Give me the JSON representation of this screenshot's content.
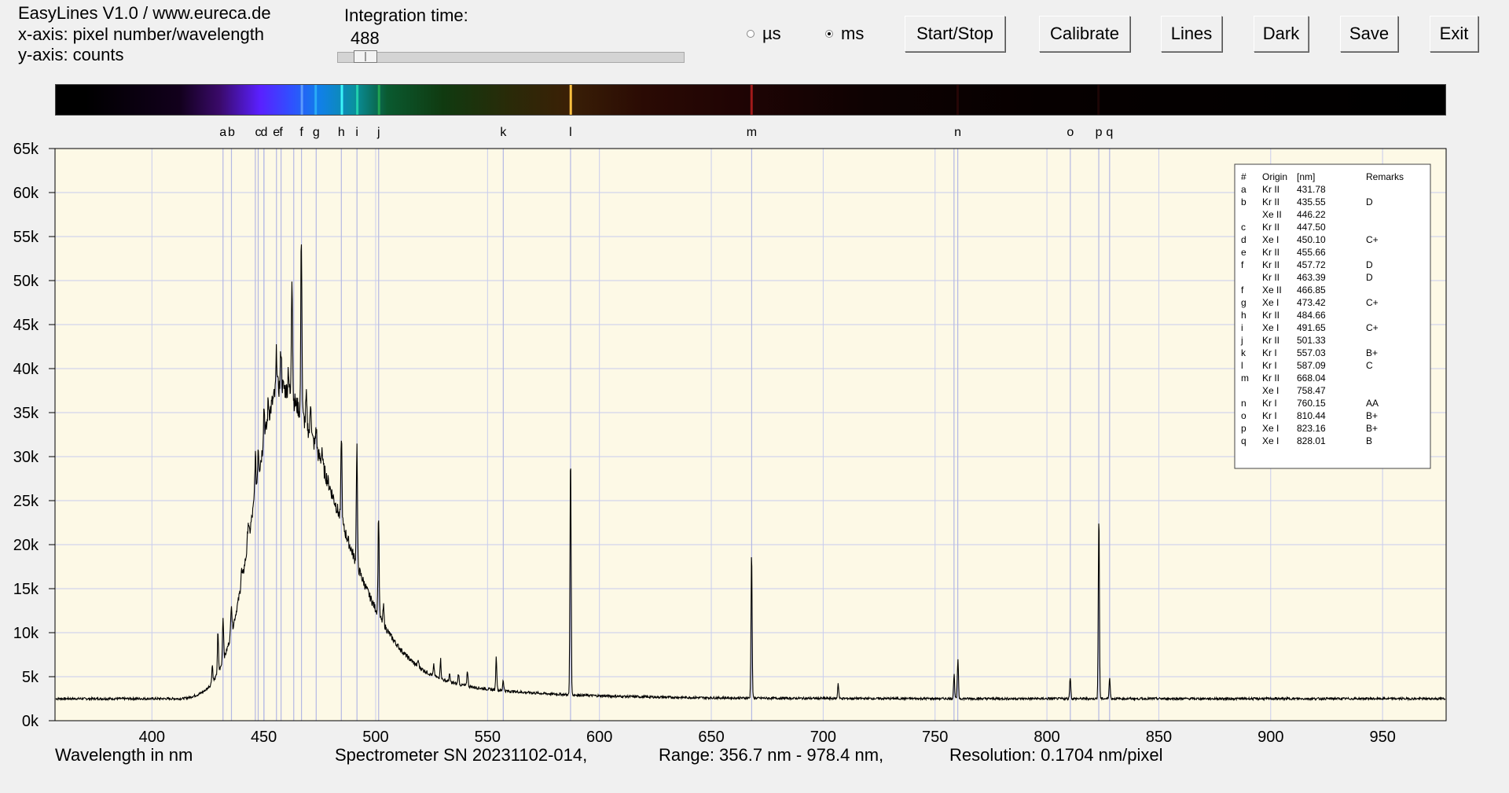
{
  "header": {
    "app_title": "EasyLines V1.0 / www.eureca.de",
    "x_axis_info": "x-axis: pixel number/wavelength",
    "y_axis_info": "y-axis: counts",
    "integration_label": "Integration time:",
    "integration_value": "488",
    "integration_slider_fraction": 0.048,
    "unit_us": "µs",
    "unit_ms": "ms",
    "selected_unit": "ms"
  },
  "toolbar": {
    "start_stop": "Start/Stop",
    "calibrate": "Calibrate",
    "lines": "Lines",
    "dark": "Dark",
    "save": "Save",
    "exit": "Exit"
  },
  "status": {
    "xlabel": "Wavelength in nm",
    "serial": "Spectrometer SN 20231102-014,",
    "range": "Range: 356.7 nm - 978.4 nm,",
    "resolution": "Resolution: 0.1704 nm/pixel"
  },
  "colors": {
    "plot_background": "#fdf9e6",
    "grid": "#c8ccee",
    "marker_line": "#b4b8e4",
    "trace": "#000000"
  },
  "line_table": {
    "headers": [
      "#",
      "Origin",
      "[nm]",
      "Remarks"
    ],
    "rows": [
      [
        "a",
        "Kr II",
        "431.78",
        ""
      ],
      [
        "b",
        "Kr II",
        "435.55",
        "D"
      ],
      [
        "",
        "Xe II",
        "446.22",
        ""
      ],
      [
        "c",
        "Kr II",
        "447.50",
        ""
      ],
      [
        "d",
        "Xe I",
        "450.10",
        "C+"
      ],
      [
        "e",
        "Kr II",
        "455.66",
        ""
      ],
      [
        "f",
        "Kr II",
        "457.72",
        "D"
      ],
      [
        "",
        "Kr II",
        "463.39",
        "D"
      ],
      [
        "f",
        "Xe II",
        "466.85",
        ""
      ],
      [
        "g",
        "Xe I",
        "473.42",
        "C+"
      ],
      [
        "h",
        "Kr II",
        "484.66",
        ""
      ],
      [
        "i",
        "Xe I",
        "491.65",
        "C+"
      ],
      [
        "j",
        "Kr II",
        "501.33",
        ""
      ],
      [
        "k",
        "Kr I",
        "557.03",
        "B+"
      ],
      [
        "l",
        "Kr I",
        "587.09",
        "C"
      ],
      [
        "m",
        "Kr II",
        "668.04",
        ""
      ],
      [
        "",
        "Xe I",
        "758.47",
        ""
      ],
      [
        "n",
        "Kr I",
        "760.15",
        "AA"
      ],
      [
        "o",
        "Kr I",
        "810.44",
        "B+"
      ],
      [
        "p",
        "Xe I",
        "823.16",
        "B+"
      ],
      [
        "q",
        "Xe I",
        "828.01",
        "B"
      ]
    ]
  },
  "chart_data": {
    "type": "line",
    "xlim": [
      356.7,
      978.4
    ],
    "ylim": [
      0,
      65000
    ],
    "x_ticks": [
      400,
      450,
      500,
      550,
      600,
      650,
      700,
      750,
      800,
      850,
      900,
      950
    ],
    "y_ticks": [
      0,
      5000,
      10000,
      15000,
      20000,
      25000,
      30000,
      35000,
      40000,
      45000,
      50000,
      55000,
      60000,
      65000
    ],
    "y_tick_labels": [
      "0k",
      "5k",
      "10k",
      "15k",
      "20k",
      "25k",
      "30k",
      "35k",
      "40k",
      "45k",
      "50k",
      "55k",
      "60k",
      "65k"
    ],
    "grid": true,
    "marker_lines": [
      {
        "label": "a",
        "wavelength": 431.78
      },
      {
        "label": "b",
        "wavelength": 435.55
      },
      {
        "label": "",
        "wavelength": 446.22
      },
      {
        "label": "c",
        "wavelength": 447.5
      },
      {
        "label": "d",
        "wavelength": 450.1
      },
      {
        "label": "e",
        "wavelength": 455.66
      },
      {
        "label": "f",
        "wavelength": 457.72
      },
      {
        "label": "",
        "wavelength": 463.39
      },
      {
        "label": "f",
        "wavelength": 466.85
      },
      {
        "label": "g",
        "wavelength": 473.42
      },
      {
        "label": "h",
        "wavelength": 484.66
      },
      {
        "label": "i",
        "wavelength": 491.65
      },
      {
        "label": "j",
        "wavelength": 501.33
      },
      {
        "label": "k",
        "wavelength": 557.03
      },
      {
        "label": "l",
        "wavelength": 587.09
      },
      {
        "label": "m",
        "wavelength": 668.04
      },
      {
        "label": "",
        "wavelength": 758.47
      },
      {
        "label": "n",
        "wavelength": 760.15
      },
      {
        "label": "o",
        "wavelength": 810.44
      },
      {
        "label": "p",
        "wavelength": 823.16
      },
      {
        "label": "q",
        "wavelength": 828.01
      }
    ],
    "baseline": 2500,
    "continuum": {
      "start": 412,
      "peak_wavelength": 458,
      "peak_value": 35500,
      "rise_width": 18,
      "decay_width": 36,
      "tail_width": 95,
      "tail_fraction": 0.25
    },
    "peaks": [
      {
        "x": 427.0,
        "y": 2000
      },
      {
        "x": 429.5,
        "y": 4500
      },
      {
        "x": 431.8,
        "y": 5000
      },
      {
        "x": 435.5,
        "y": 3500
      },
      {
        "x": 440.0,
        "y": 1500
      },
      {
        "x": 443.0,
        "y": 2500
      },
      {
        "x": 446.2,
        "y": 4500
      },
      {
        "x": 447.5,
        "y": 3500
      },
      {
        "x": 450.1,
        "y": 4000
      },
      {
        "x": 452.0,
        "y": 2000
      },
      {
        "x": 455.7,
        "y": 4500
      },
      {
        "x": 457.7,
        "y": 4500
      },
      {
        "x": 461.0,
        "y": 3000
      },
      {
        "x": 462.6,
        "y": 14500
      },
      {
        "x": 466.8,
        "y": 20500
      },
      {
        "x": 469.0,
        "y": 3000
      },
      {
        "x": 471.0,
        "y": 4000
      },
      {
        "x": 473.4,
        "y": 2500
      },
      {
        "x": 476.0,
        "y": 2000
      },
      {
        "x": 484.7,
        "y": 10000
      },
      {
        "x": 491.6,
        "y": 13500
      },
      {
        "x": 501.3,
        "y": 11500
      },
      {
        "x": 503.5,
        "y": 2000
      },
      {
        "x": 519.0,
        "y": 700
      },
      {
        "x": 526.0,
        "y": 1200
      },
      {
        "x": 529.0,
        "y": 2200
      },
      {
        "x": 533.0,
        "y": 800
      },
      {
        "x": 537.0,
        "y": 1200
      },
      {
        "x": 541.0,
        "y": 1800
      },
      {
        "x": 553.9,
        "y": 3700
      },
      {
        "x": 557.0,
        "y": 1200
      },
      {
        "x": 587.1,
        "y": 27300
      },
      {
        "x": 668.0,
        "y": 16500
      },
      {
        "x": 706.7,
        "y": 1700
      },
      {
        "x": 758.5,
        "y": 2700
      },
      {
        "x": 760.2,
        "y": 4300
      },
      {
        "x": 810.4,
        "y": 2500
      },
      {
        "x": 823.2,
        "y": 21000
      },
      {
        "x": 828.0,
        "y": 2400
      }
    ]
  }
}
